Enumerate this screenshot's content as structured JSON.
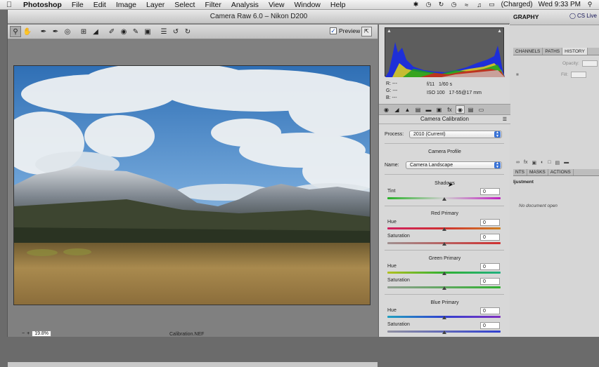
{
  "menubar": {
    "app_name": "Photoshop",
    "menus": [
      "File",
      "Edit",
      "Image",
      "Layer",
      "Select",
      "Filter",
      "Analysis",
      "View",
      "Window",
      "Help"
    ],
    "battery_status": "(Charged)",
    "clock": "Wed 9:33 PM"
  },
  "photoshop": {
    "workspace_label": "GRAPHY",
    "cs_live": "CS Live",
    "layer_tabs": [
      "CHANNELS",
      "PATHS",
      "HISTORY"
    ],
    "opacity_label": "Opacity:",
    "fill_label": "Fill:",
    "adjust_tabs": [
      "NTS",
      "MASKS",
      "ACTIONS"
    ],
    "adjust_title": "ljustment",
    "no_document": "No document open"
  },
  "camera_raw": {
    "window_title": "Camera Raw 6.0  –  Nikon D200",
    "preview_label": "Preview",
    "preview_checked": true,
    "zoom_value": "19.8%",
    "filename": "Calibration.NEF",
    "readout": {
      "r": "R:  ---",
      "g": "G:  ---",
      "b": "B:  ---",
      "aperture": "f/11",
      "shutter": "1/60 s",
      "iso": "ISO 100",
      "lens": "17-55@17 mm"
    },
    "panel_title": "Camera Calibration",
    "process_label": "Process:",
    "process_value": "2010 (Current)",
    "camera_profile_heading": "Camera Profile",
    "name_label": "Name:",
    "name_value": "Camera Landscape",
    "shadows": {
      "heading": "Shadows",
      "tint_label": "Tint",
      "tint_value": "0"
    },
    "red_primary": {
      "heading": "Red Primary",
      "hue_label": "Hue",
      "hue_value": "0",
      "sat_label": "Saturation",
      "sat_value": "0"
    },
    "green_primary": {
      "heading": "Green Primary",
      "hue_label": "Hue",
      "hue_value": "0",
      "sat_label": "Saturation",
      "sat_value": "0"
    },
    "blue_primary": {
      "heading": "Blue Primary",
      "hue_label": "Hue",
      "hue_value": "0",
      "sat_label": "Saturation",
      "sat_value": "0"
    }
  }
}
